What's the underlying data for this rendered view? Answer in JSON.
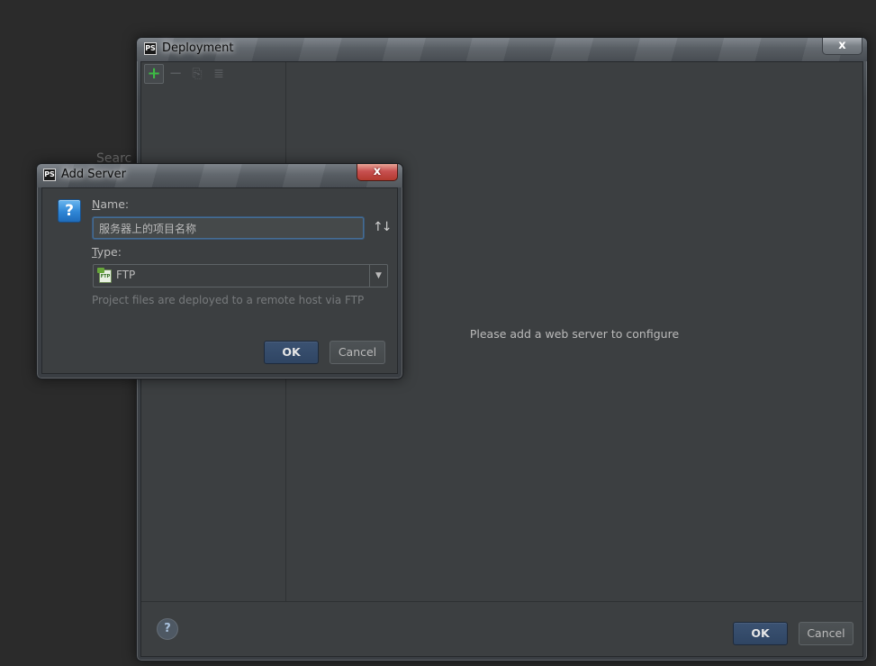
{
  "background": {
    "search_text": "Searc"
  },
  "deployment": {
    "title": "Deployment",
    "close_glyph": "x",
    "toolbar": {
      "add_glyph": "+",
      "remove_glyph": "−",
      "copy_glyph": "⎘",
      "move_glyph": "≣"
    },
    "empty_message": "Please add a web server to configure",
    "help_glyph": "?",
    "ok_label": "OK",
    "cancel_label": "Cancel"
  },
  "add_server": {
    "title": "Add Server",
    "close_glyph": "x",
    "question_glyph": "?",
    "name_label_mnemonic": "N",
    "name_label_rest": "ame:",
    "name_value": "服务器上的项目名称",
    "sort_glyph": "↑↓",
    "type_label_mnemonic": "T",
    "type_label_rest": "ype:",
    "type_icon_text": "FTP",
    "type_value": "FTP",
    "type_dropdown_glyph": "▼",
    "hint": "Project files are deployed to a remote host via FTP",
    "ok_label": "OK",
    "cancel_label": "Cancel"
  },
  "app_icon_text": "PS",
  "colors": {
    "accent_add": "#3dbb44",
    "ok_button": "#34496a",
    "close_red": "#c75050",
    "focus_border": "#466d94"
  }
}
